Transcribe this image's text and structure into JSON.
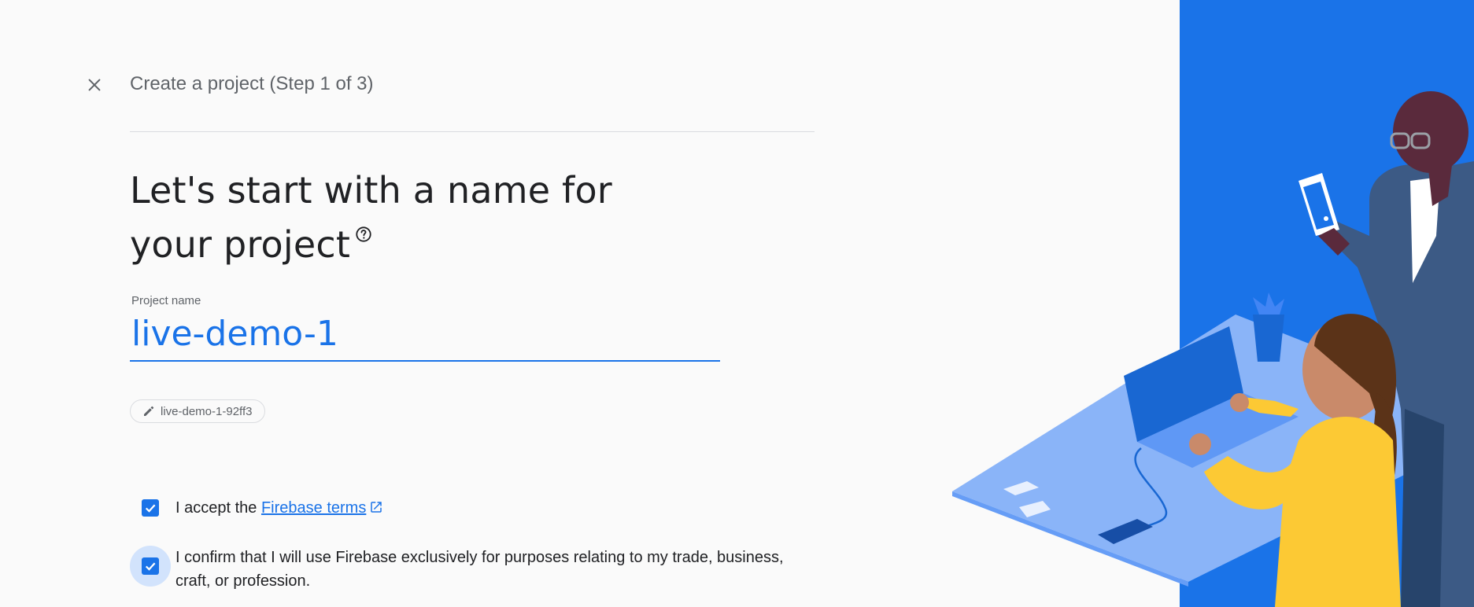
{
  "header": {
    "title": "Create a project (Step 1 of 3)"
  },
  "heading": {
    "line1": "Let's start with a name for",
    "line2": "your project"
  },
  "project_field": {
    "label": "Project name",
    "value": "live-demo-1"
  },
  "project_id_chip": {
    "label": "live-demo-1-92ff3"
  },
  "terms": {
    "prefix": "I accept the ",
    "link_label": "Firebase terms",
    "checked": true
  },
  "confirm": {
    "text": "I confirm that I will use Firebase exclusively for purposes relating to my trade, business, craft, or profession.",
    "checked": true
  },
  "colors": {
    "accent": "#1a73e8",
    "illustration_bg": "#1a73e8",
    "focus_halo": "#d2e3fc"
  },
  "icons": {
    "close": "close-icon",
    "help": "help-circle-icon",
    "edit": "pencil-icon",
    "external": "open-in-new-icon",
    "check": "check-icon"
  }
}
